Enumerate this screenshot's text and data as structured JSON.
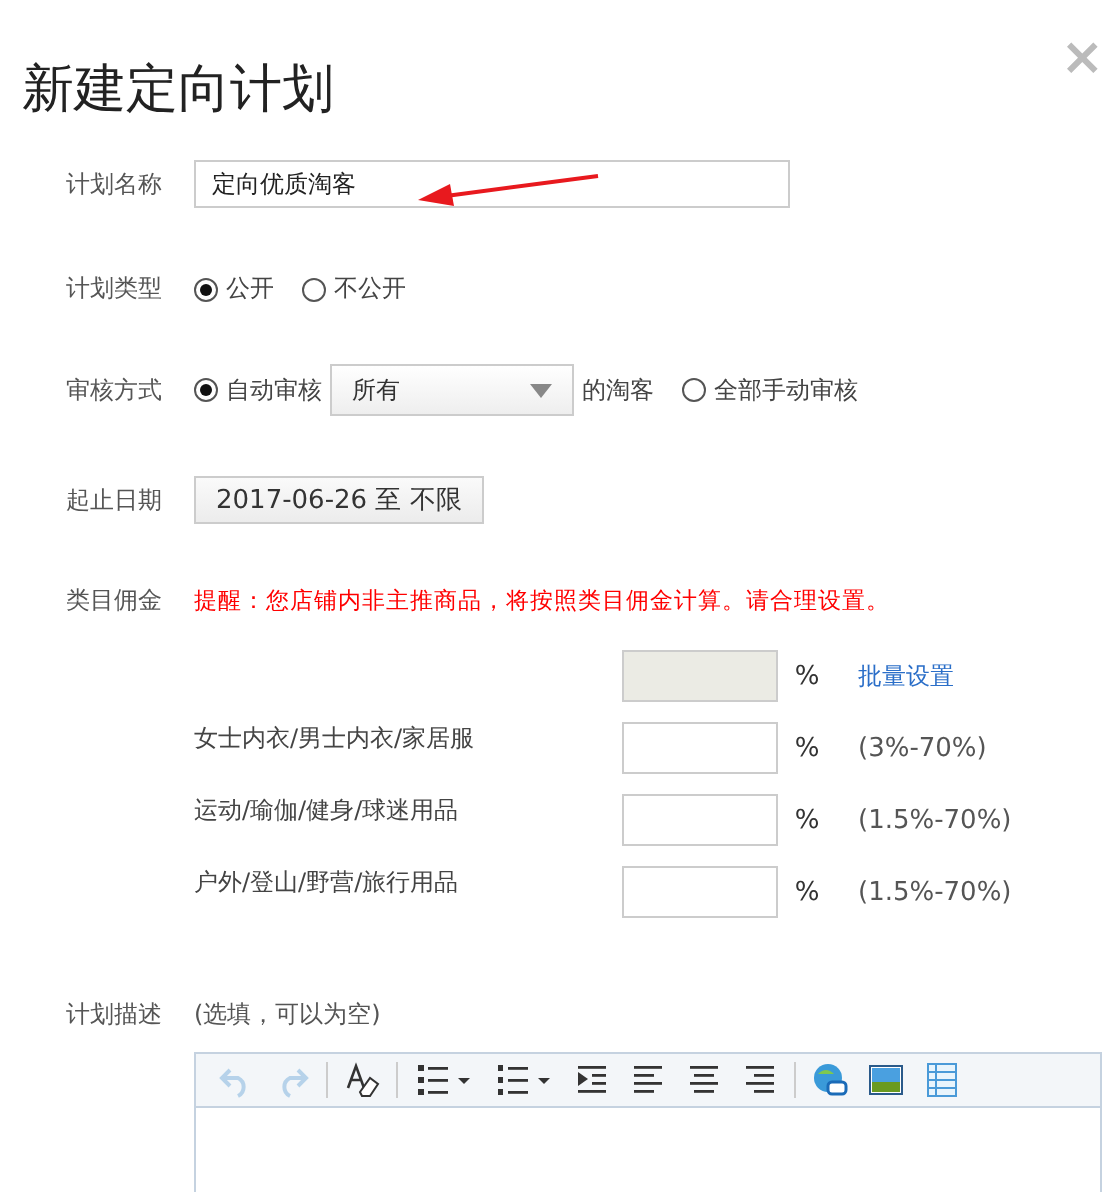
{
  "title": "新建定向计划",
  "close": "×",
  "name_row": {
    "label": "计划名称",
    "value": "定向优质淘客"
  },
  "type_row": {
    "label": "计划类型",
    "options": [
      {
        "label": "公开",
        "selected": true
      },
      {
        "label": "不公开",
        "selected": false
      }
    ]
  },
  "review_row": {
    "label": "审核方式",
    "options": [
      {
        "kind": "auto",
        "label": "自动审核",
        "selected": true,
        "select_value": "所有",
        "suffix": "的淘客"
      },
      {
        "kind": "manual",
        "label": "全部手动审核",
        "selected": false
      }
    ]
  },
  "date_row": {
    "label": "起止日期",
    "value": "2017-06-26 至 不限"
  },
  "commission": {
    "label": "类目佣金",
    "warning": "提醒：您店铺内非主推商品，将按照类目佣金计算。请合理设置。",
    "bulk": {
      "unit": "%",
      "link": "批量设置"
    },
    "categories": [
      {
        "name": "女士内衣/男士内衣/家居服",
        "unit": "%",
        "range": "(3%-70%)"
      },
      {
        "name": "运动/瑜伽/健身/球迷用品",
        "unit": "%",
        "range": "(1.5%-70%)"
      },
      {
        "name": "户外/登山/野营/旅行用品",
        "unit": "%",
        "range": "(1.5%-70%)"
      }
    ]
  },
  "description": {
    "label": "计划描述",
    "hint": "(选填，可以为空)",
    "toolbar": [
      {
        "kind": "undo",
        "disabled": true
      },
      {
        "kind": "redo",
        "disabled": true
      },
      {
        "kind": "sep"
      },
      {
        "kind": "clear-format",
        "disabled": false
      },
      {
        "kind": "sep"
      },
      {
        "kind": "bullet-list",
        "disabled": false
      },
      {
        "kind": "number-list",
        "disabled": false
      },
      {
        "kind": "indent",
        "disabled": false
      },
      {
        "kind": "align-left",
        "disabled": false
      },
      {
        "kind": "align-center",
        "disabled": false
      },
      {
        "kind": "align-right",
        "disabled": false
      },
      {
        "kind": "sep"
      },
      {
        "kind": "link",
        "disabled": false
      },
      {
        "kind": "image",
        "disabled": false
      },
      {
        "kind": "table",
        "disabled": false
      }
    ]
  }
}
